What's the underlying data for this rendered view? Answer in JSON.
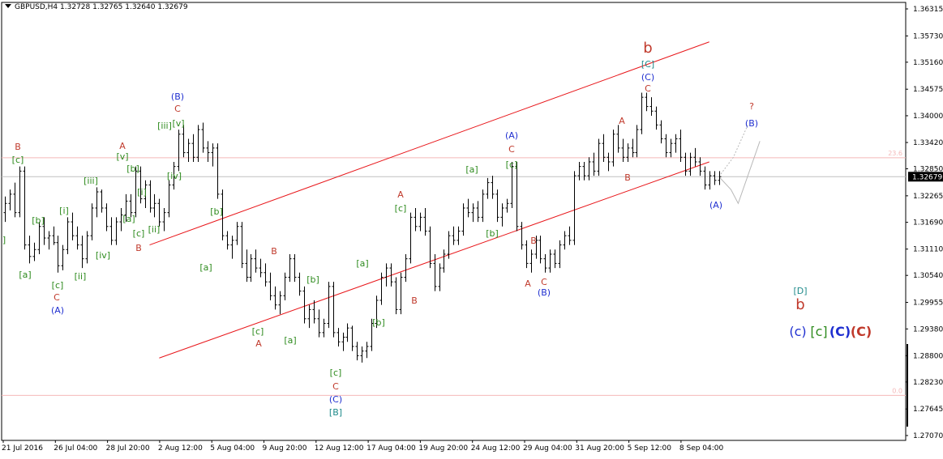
{
  "header": {
    "symbol": "GBPUSD,H4",
    "open": "1.32728",
    "high": "1.32765",
    "low": "1.32640",
    "close": "1.32679"
  },
  "colors": {
    "background": "#ffffff",
    "bars": "#000000",
    "channel": "#e8161a",
    "fib_lines": "#f4b8b8",
    "price_line": "#c0c0c0",
    "projection": "#b8b8b8",
    "wave_red": "#c0392b",
    "wave_green": "#2e8b1e",
    "wave_blue": "#1f2fd0",
    "wave_teal": "#1f8a8a",
    "price_tag_bg": "#000000",
    "price_tag_text": "#ffffff"
  },
  "chart_data": {
    "type": "ohlc",
    "symbol": "GBPUSD",
    "timeframe": "H4",
    "ylim": [
      1.2707,
      1.36315
    ],
    "y_ticks": [
      "1.36315",
      "1.35730",
      "1.35160",
      "1.34575",
      "1.34000",
      "1.33420",
      "1.32850",
      "1.32265",
      "1.31690",
      "1.31110",
      "1.30540",
      "1.29955",
      "1.29380",
      "1.28800",
      "1.28230",
      "1.27645",
      "1.27070"
    ],
    "x_ticks": [
      "21 Jul 2016",
      "26 Jul 04:00",
      "28 Jul 20:00",
      "2 Aug 12:00",
      "5 Aug 04:00",
      "9 Aug 20:00",
      "12 Aug 12:00",
      "17 Aug 04:00",
      "19 Aug 20:00",
      "24 Aug 12:00",
      "29 Aug 04:00",
      "31 Aug 20:00",
      "5 Sep 12:00",
      "8 Sep 04:00"
    ],
    "current_price": "1.32679",
    "fib_levels": [
      {
        "label": "23.6",
        "price": 1.3309
      },
      {
        "label": "0.0",
        "price": 1.2794
      }
    ],
    "bars": [
      [
        1.319,
        1.3225,
        1.317,
        1.321
      ],
      [
        1.321,
        1.324,
        1.3195,
        1.323
      ],
      [
        1.323,
        1.3255,
        1.318,
        1.319
      ],
      [
        1.319,
        1.329,
        1.318,
        1.328
      ],
      [
        1.328,
        1.329,
        1.311,
        1.312
      ],
      [
        1.312,
        1.314,
        1.308,
        1.3095
      ],
      [
        1.3095,
        1.3125,
        1.3085,
        1.311
      ],
      [
        1.311,
        1.317,
        1.31,
        1.316
      ],
      [
        1.316,
        1.318,
        1.312,
        1.3135
      ],
      [
        1.3135,
        1.315,
        1.311,
        1.314
      ],
      [
        1.314,
        1.316,
        1.312,
        1.3125
      ],
      [
        1.3125,
        1.314,
        1.306,
        1.3075
      ],
      [
        1.3075,
        1.312,
        1.3065,
        1.311
      ],
      [
        1.311,
        1.318,
        1.31,
        1.317
      ],
      [
        1.317,
        1.319,
        1.313,
        1.314
      ],
      [
        1.314,
        1.316,
        1.311,
        1.312
      ],
      [
        1.312,
        1.314,
        1.307,
        1.309
      ],
      [
        1.309,
        1.315,
        1.308,
        1.314
      ],
      [
        1.314,
        1.321,
        1.313,
        1.32
      ],
      [
        1.32,
        1.3245,
        1.318,
        1.3235
      ],
      [
        1.3235,
        1.324,
        1.319,
        1.32
      ],
      [
        1.32,
        1.321,
        1.315,
        1.316
      ],
      [
        1.316,
        1.318,
        1.312,
        1.313
      ],
      [
        1.313,
        1.318,
        1.312,
        1.317
      ],
      [
        1.317,
        1.32,
        1.315,
        1.3185
      ],
      [
        1.3185,
        1.323,
        1.317,
        1.3215
      ],
      [
        1.3215,
        1.323,
        1.318,
        1.319
      ],
      [
        1.319,
        1.329,
        1.318,
        1.328
      ],
      [
        1.328,
        1.329,
        1.321,
        1.322
      ],
      [
        1.322,
        1.326,
        1.32,
        1.325
      ],
      [
        1.325,
        1.326,
        1.319,
        1.32
      ],
      [
        1.32,
        1.323,
        1.318,
        1.321
      ],
      [
        1.321,
        1.322,
        1.316,
        1.317
      ],
      [
        1.317,
        1.32,
        1.315,
        1.319
      ],
      [
        1.319,
        1.326,
        1.318,
        1.325
      ],
      [
        1.325,
        1.33,
        1.324,
        1.329
      ],
      [
        1.329,
        1.337,
        1.328,
        1.336
      ],
      [
        1.336,
        1.338,
        1.331,
        1.332
      ],
      [
        1.332,
        1.335,
        1.33,
        1.334
      ],
      [
        1.334,
        1.336,
        1.33,
        1.331
      ],
      [
        1.331,
        1.338,
        1.33,
        1.337
      ],
      [
        1.337,
        1.3385,
        1.332,
        1.333
      ],
      [
        1.333,
        1.3345,
        1.33,
        1.332
      ],
      [
        1.332,
        1.334,
        1.329,
        1.333
      ],
      [
        1.333,
        1.334,
        1.322,
        1.323
      ],
      [
        1.323,
        1.324,
        1.313,
        1.314
      ],
      [
        1.314,
        1.315,
        1.311,
        1.312
      ],
      [
        1.312,
        1.314,
        1.309,
        1.313
      ],
      [
        1.313,
        1.317,
        1.312,
        1.316
      ],
      [
        1.316,
        1.317,
        1.307,
        1.308
      ],
      [
        1.308,
        1.311,
        1.304,
        1.305
      ],
      [
        1.305,
        1.31,
        1.304,
        1.309
      ],
      [
        1.309,
        1.311,
        1.306,
        1.307
      ],
      [
        1.307,
        1.309,
        1.305,
        1.306
      ],
      [
        1.306,
        1.308,
        1.303,
        1.304
      ],
      [
        1.304,
        1.306,
        1.3,
        1.301
      ],
      [
        1.301,
        1.303,
        1.298,
        1.299
      ],
      [
        1.299,
        1.302,
        1.297,
        1.301
      ],
      [
        1.301,
        1.306,
        1.3,
        1.305
      ],
      [
        1.305,
        1.31,
        1.304,
        1.309
      ],
      [
        1.309,
        1.31,
        1.304,
        1.305
      ],
      [
        1.305,
        1.306,
        1.301,
        1.302
      ],
      [
        1.302,
        1.303,
        1.295,
        1.296
      ],
      [
        1.296,
        1.299,
        1.294,
        1.298
      ],
      [
        1.298,
        1.3,
        1.295,
        1.296
      ],
      [
        1.296,
        1.298,
        1.292,
        1.293
      ],
      [
        1.293,
        1.296,
        1.292,
        1.295
      ],
      [
        1.295,
        1.304,
        1.294,
        1.303
      ],
      [
        1.303,
        1.304,
        1.292,
        1.293
      ],
      [
        1.293,
        1.294,
        1.29,
        1.291
      ],
      [
        1.291,
        1.293,
        1.289,
        1.292
      ],
      [
        1.292,
        1.295,
        1.291,
        1.294
      ],
      [
        1.294,
        1.2945,
        1.289,
        1.29
      ],
      [
        1.29,
        1.291,
        1.287,
        1.288
      ],
      [
        1.288,
        1.29,
        1.2865,
        1.289
      ],
      [
        1.289,
        1.291,
        1.2875,
        1.29
      ],
      [
        1.29,
        1.296,
        1.289,
        1.295
      ],
      [
        1.295,
        1.301,
        1.294,
        1.3
      ],
      [
        1.3,
        1.306,
        1.299,
        1.305
      ],
      [
        1.305,
        1.308,
        1.303,
        1.307
      ],
      [
        1.307,
        1.308,
        1.303,
        1.304
      ],
      [
        1.304,
        1.305,
        1.297,
        1.298
      ],
      [
        1.298,
        1.306,
        1.297,
        1.305
      ],
      [
        1.305,
        1.31,
        1.304,
        1.309
      ],
      [
        1.309,
        1.319,
        1.308,
        1.318
      ],
      [
        1.318,
        1.32,
        1.315,
        1.316
      ],
      [
        1.316,
        1.319,
        1.315,
        1.318
      ],
      [
        1.318,
        1.32,
        1.314,
        1.315
      ],
      [
        1.315,
        1.316,
        1.307,
        1.308
      ],
      [
        1.308,
        1.31,
        1.302,
        1.303
      ],
      [
        1.303,
        1.308,
        1.302,
        1.307
      ],
      [
        1.307,
        1.311,
        1.306,
        1.31
      ],
      [
        1.31,
        1.315,
        1.309,
        1.314
      ],
      [
        1.314,
        1.316,
        1.312,
        1.313
      ],
      [
        1.313,
        1.316,
        1.312,
        1.315
      ],
      [
        1.315,
        1.321,
        1.314,
        1.32
      ],
      [
        1.32,
        1.322,
        1.318,
        1.319
      ],
      [
        1.319,
        1.321,
        1.317,
        1.32
      ],
      [
        1.32,
        1.3215,
        1.317,
        1.318
      ],
      [
        1.318,
        1.324,
        1.317,
        1.323
      ],
      [
        1.323,
        1.3265,
        1.322,
        1.3255
      ],
      [
        1.3255,
        1.327,
        1.322,
        1.323
      ],
      [
        1.323,
        1.324,
        1.317,
        1.318
      ],
      [
        1.318,
        1.321,
        1.316,
        1.32
      ],
      [
        1.32,
        1.322,
        1.319,
        1.321
      ],
      [
        1.321,
        1.33,
        1.32,
        1.329
      ],
      [
        1.329,
        1.33,
        1.315,
        1.316
      ],
      [
        1.316,
        1.317,
        1.311,
        1.312
      ],
      [
        1.312,
        1.313,
        1.307,
        1.308
      ],
      [
        1.308,
        1.311,
        1.306,
        1.31
      ],
      [
        1.31,
        1.314,
        1.309,
        1.313
      ],
      [
        1.313,
        1.314,
        1.308,
        1.309
      ],
      [
        1.309,
        1.31,
        1.306,
        1.307
      ],
      [
        1.307,
        1.311,
        1.306,
        1.31
      ],
      [
        1.31,
        1.311,
        1.307,
        1.308
      ],
      [
        1.308,
        1.313,
        1.307,
        1.312
      ],
      [
        1.312,
        1.315,
        1.311,
        1.314
      ],
      [
        1.314,
        1.316,
        1.312,
        1.313
      ],
      [
        1.313,
        1.328,
        1.312,
        1.327
      ],
      [
        1.327,
        1.33,
        1.326,
        1.329
      ],
      [
        1.329,
        1.33,
        1.326,
        1.327
      ],
      [
        1.327,
        1.331,
        1.326,
        1.33
      ],
      [
        1.33,
        1.332,
        1.327,
        1.328
      ],
      [
        1.328,
        1.335,
        1.327,
        1.334
      ],
      [
        1.334,
        1.336,
        1.33,
        1.331
      ],
      [
        1.331,
        1.332,
        1.328,
        1.33
      ],
      [
        1.33,
        1.337,
        1.329,
        1.336
      ],
      [
        1.336,
        1.338,
        1.332,
        1.333
      ],
      [
        1.333,
        1.335,
        1.33,
        1.331
      ],
      [
        1.331,
        1.334,
        1.33,
        1.333
      ],
      [
        1.333,
        1.335,
        1.331,
        1.332
      ],
      [
        1.332,
        1.338,
        1.331,
        1.337
      ],
      [
        1.337,
        1.345,
        1.336,
        1.344
      ],
      [
        1.344,
        1.345,
        1.341,
        1.342
      ],
      [
        1.342,
        1.344,
        1.34,
        1.341
      ],
      [
        1.341,
        1.342,
        1.337,
        1.338
      ],
      [
        1.338,
        1.339,
        1.334,
        1.335
      ],
      [
        1.335,
        1.336,
        1.331,
        1.332
      ],
      [
        1.332,
        1.335,
        1.331,
        1.334
      ],
      [
        1.334,
        1.336,
        1.332,
        1.335
      ],
      [
        1.335,
        1.337,
        1.33,
        1.331
      ],
      [
        1.331,
        1.332,
        1.327,
        1.328
      ],
      [
        1.328,
        1.332,
        1.327,
        1.331
      ],
      [
        1.331,
        1.333,
        1.329,
        1.33
      ],
      [
        1.33,
        1.331,
        1.327,
        1.328
      ],
      [
        1.328,
        1.329,
        1.324,
        1.325
      ],
      [
        1.325,
        1.328,
        1.324,
        1.327
      ],
      [
        1.327,
        1.328,
        1.325,
        1.326
      ],
      [
        1.326,
        1.328,
        1.325,
        1.3268
      ]
    ],
    "channel_lines": [
      {
        "from": [
          30,
          1.312
        ],
        "to": [
          146,
          1.356
        ]
      },
      {
        "from": [
          32,
          1.2875
        ],
        "to": [
          146,
          1.33
        ]
      }
    ]
  },
  "wave_labels": [
    {
      "t": "B",
      "c": "red",
      "x": 22,
      "y": 181
    },
    {
      "t": "[c]",
      "c": "green",
      "x": 22,
      "y": 197
    },
    {
      "t": "]",
      "c": "green",
      "x": 5,
      "y": 296
    },
    {
      "t": "[a]",
      "c": "green",
      "x": 31,
      "y": 339
    },
    {
      "t": "[b]",
      "c": "green",
      "x": 47,
      "y": 272
    },
    {
      "t": "[c]",
      "c": "green",
      "x": 71,
      "y": 352
    },
    {
      "t": "C",
      "c": "red",
      "x": 70,
      "y": 367
    },
    {
      "t": "(A)",
      "c": "blue",
      "x": 71,
      "y": 383
    },
    {
      "t": "[i]",
      "c": "green",
      "x": 79,
      "y": 260
    },
    {
      "t": "[ii]",
      "c": "green",
      "x": 99,
      "y": 341
    },
    {
      "t": "[iii]",
      "c": "green",
      "x": 112,
      "y": 223
    },
    {
      "t": "[iv]",
      "c": "green",
      "x": 127,
      "y": 315
    },
    {
      "t": "A",
      "c": "red",
      "x": 151,
      "y": 180
    },
    {
      "t": "[v]",
      "c": "green",
      "x": 151,
      "y": 193
    },
    {
      "t": "[b]",
      "c": "green",
      "x": 164,
      "y": 208
    },
    {
      "t": "[i]",
      "c": "green",
      "x": 175,
      "y": 237
    },
    {
      "t": "[a]",
      "c": "green",
      "x": 159,
      "y": 270
    },
    {
      "t": "[c]",
      "c": "green",
      "x": 171,
      "y": 288
    },
    {
      "t": "[ii]",
      "c": "green",
      "x": 190,
      "y": 283
    },
    {
      "t": "B",
      "c": "red",
      "x": 171,
      "y": 306
    },
    {
      "t": "(B)",
      "c": "blue",
      "x": 219,
      "y": 119
    },
    {
      "t": "C",
      "c": "red",
      "x": 219,
      "y": 134
    },
    {
      "t": "[iii]",
      "c": "green",
      "x": 203,
      "y": 155
    },
    {
      "t": "[v]",
      "c": "green",
      "x": 220,
      "y": 152
    },
    {
      "t": "[iv]",
      "c": "green",
      "x": 215,
      "y": 217
    },
    {
      "t": "[b]",
      "c": "green",
      "x": 267,
      "y": 261
    },
    {
      "t": "[a]",
      "c": "green",
      "x": 254,
      "y": 330
    },
    {
      "t": "B",
      "c": "red",
      "x": 338,
      "y": 310
    },
    {
      "t": "[c]",
      "c": "green",
      "x": 318,
      "y": 409
    },
    {
      "t": "A",
      "c": "red",
      "x": 319,
      "y": 424
    },
    {
      "t": "[b]",
      "c": "green",
      "x": 386,
      "y": 345
    },
    {
      "t": "[a]",
      "c": "green",
      "x": 358,
      "y": 420
    },
    {
      "t": "[c]",
      "c": "green",
      "x": 414,
      "y": 460
    },
    {
      "t": "C",
      "c": "red",
      "x": 414,
      "y": 477
    },
    {
      "t": "(C)",
      "c": "blue",
      "x": 414,
      "y": 493
    },
    {
      "t": "[B]",
      "c": "teal",
      "x": 414,
      "y": 509
    },
    {
      "t": "[a]",
      "c": "green",
      "x": 447,
      "y": 325
    },
    {
      "t": "[b]",
      "c": "green",
      "x": 467,
      "y": 398
    },
    {
      "t": "A",
      "c": "red",
      "x": 494,
      "y": 240
    },
    {
      "t": "[c]",
      "c": "green",
      "x": 494,
      "y": 257
    },
    {
      "t": "B",
      "c": "red",
      "x": 511,
      "y": 371
    },
    {
      "t": "[a]",
      "c": "green",
      "x": 582,
      "y": 209
    },
    {
      "t": "[b]",
      "c": "green",
      "x": 607,
      "y": 288
    },
    {
      "t": "(A)",
      "c": "blue",
      "x": 631,
      "y": 167
    },
    {
      "t": "C",
      "c": "red",
      "x": 631,
      "y": 184
    },
    {
      "t": "[c]",
      "c": "green",
      "x": 631,
      "y": 203
    },
    {
      "t": "B",
      "c": "red",
      "x": 658,
      "y": 297
    },
    {
      "t": "A",
      "c": "red",
      "x": 651,
      "y": 350
    },
    {
      "t": "C",
      "c": "red",
      "x": 671,
      "y": 348
    },
    {
      "t": "(B)",
      "c": "blue",
      "x": 671,
      "y": 361
    },
    {
      "t": "A",
      "c": "red",
      "x": 767,
      "y": 149
    },
    {
      "t": "B",
      "c": "red",
      "x": 774,
      "y": 219
    },
    {
      "t": "b",
      "c": "red",
      "x": 799,
      "y": 61,
      "big": 1
    },
    {
      "t": "[C]",
      "c": "teal",
      "x": 799,
      "y": 79
    },
    {
      "t": "(C)",
      "c": "blue",
      "x": 799,
      "y": 95
    },
    {
      "t": "C",
      "c": "red",
      "x": 799,
      "y": 109
    },
    {
      "t": "?",
      "c": "red",
      "x": 927,
      "y": 131
    },
    {
      "t": "(B)",
      "c": "blue",
      "x": 927,
      "y": 152
    },
    {
      "t": "(A)",
      "c": "blue",
      "x": 883,
      "y": 253
    },
    {
      "t": "[D]",
      "c": "teal",
      "x": 987,
      "y": 359
    },
    {
      "t": "b",
      "c": "red",
      "x": 987,
      "y": 378,
      "big": 1
    }
  ],
  "legend": [
    {
      "t": "(c)",
      "c": "blue",
      "bold": false
    },
    {
      "t": "[c]",
      "c": "green",
      "bold": false
    },
    {
      "t": "(C)",
      "c": "blue",
      "bold": true
    },
    {
      "t": "(C)",
      "c": "red",
      "bold": true
    }
  ]
}
